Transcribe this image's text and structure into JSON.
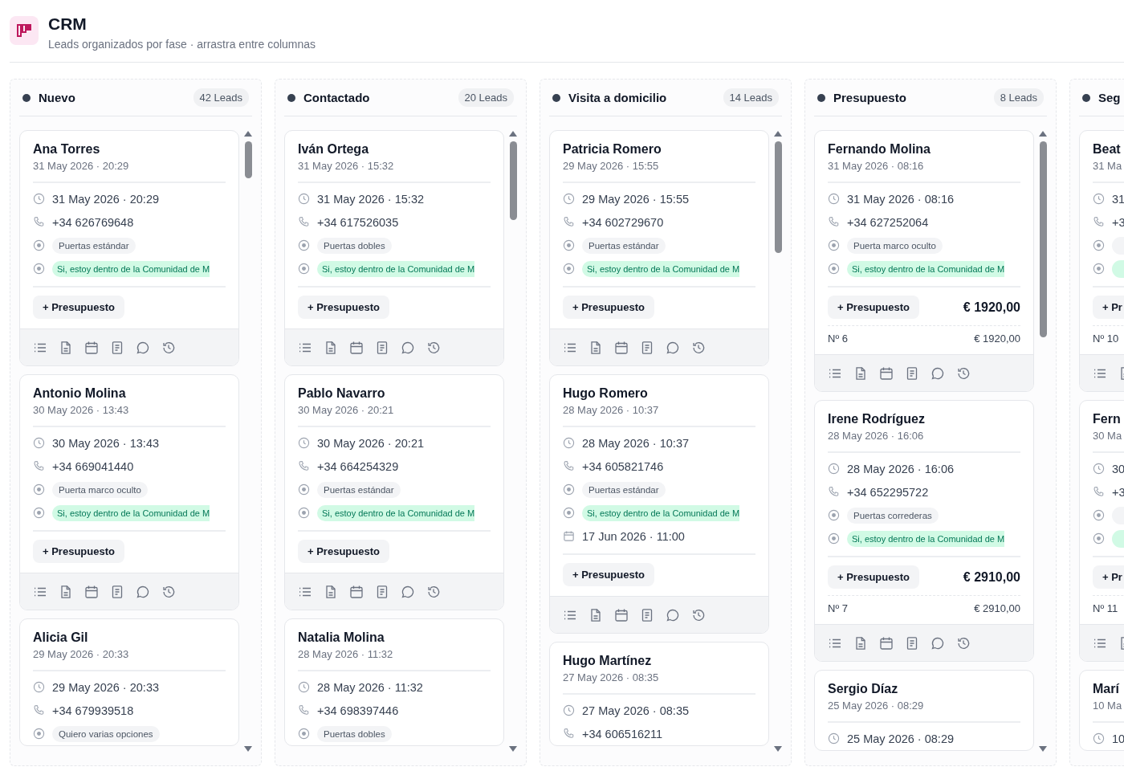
{
  "header": {
    "title": "CRM",
    "subtitle": "Leads organizados por fase · arrastra entre columnas"
  },
  "columns": [
    {
      "name": "Nuevo",
      "count": "42 Leads",
      "cards": [
        {
          "name": "Ana Torres",
          "created": "31 May 2026 · 20:29",
          "rows": [
            {
              "kind": "time",
              "text": "31 May 2026 · 20:29"
            },
            {
              "kind": "phone",
              "text": "+34 626769648"
            },
            {
              "kind": "tag",
              "text": "Puertas estándar"
            },
            {
              "kind": "tag-green",
              "text": "Si, estoy dentro de la Comunidad de M"
            }
          ],
          "button": "+ Presupuesto"
        },
        {
          "name": "Antonio Molina",
          "created": "30 May 2026 · 13:43",
          "rows": [
            {
              "kind": "time",
              "text": "30 May 2026 · 13:43"
            },
            {
              "kind": "phone",
              "text": "+34 669041440"
            },
            {
              "kind": "tag",
              "text": "Puerta marco oculto"
            },
            {
              "kind": "tag-green",
              "text": "Si, estoy dentro de la Comunidad de M"
            }
          ],
          "button": "+ Presupuesto"
        },
        {
          "name": "Alicia Gil",
          "created": "29 May 2026 · 20:33",
          "rows": [
            {
              "kind": "time",
              "text": "29 May 2026 · 20:33"
            },
            {
              "kind": "phone",
              "text": "+34 679939518"
            },
            {
              "kind": "tag",
              "text": "Quiero varias opciones"
            }
          ]
        }
      ]
    },
    {
      "name": "Contactado",
      "count": "20 Leads",
      "cards": [
        {
          "name": "Iván Ortega",
          "created": "31 May 2026 · 15:32",
          "rows": [
            {
              "kind": "time",
              "text": "31 May 2026 · 15:32"
            },
            {
              "kind": "phone",
              "text": "+34 617526035"
            },
            {
              "kind": "tag",
              "text": "Puertas dobles"
            },
            {
              "kind": "tag-green",
              "text": "Si, estoy dentro de la Comunidad de M"
            }
          ],
          "button": "+ Presupuesto"
        },
        {
          "name": "Pablo Navarro",
          "created": "30 May 2026 · 20:21",
          "rows": [
            {
              "kind": "time",
              "text": "30 May 2026 · 20:21"
            },
            {
              "kind": "phone",
              "text": "+34 664254329"
            },
            {
              "kind": "tag",
              "text": "Puertas estándar"
            },
            {
              "kind": "tag-green",
              "text": "Si, estoy dentro de la Comunidad de M"
            }
          ],
          "button": "+ Presupuesto"
        },
        {
          "name": "Natalia Molina",
          "created": "28 May 2026 · 11:32",
          "rows": [
            {
              "kind": "time",
              "text": "28 May 2026 · 11:32"
            },
            {
              "kind": "phone",
              "text": "+34 698397446"
            },
            {
              "kind": "tag",
              "text": "Puertas dobles"
            }
          ]
        }
      ]
    },
    {
      "name": "Visita a domicilio",
      "count": "14 Leads",
      "cards": [
        {
          "name": "Patricia Romero",
          "created": "29 May 2026 · 15:55",
          "rows": [
            {
              "kind": "time",
              "text": "29 May 2026 · 15:55"
            },
            {
              "kind": "phone",
              "text": "+34 602729670"
            },
            {
              "kind": "tag",
              "text": "Puertas estándar"
            },
            {
              "kind": "tag-green",
              "text": "Si, estoy dentro de la Comunidad de M"
            }
          ],
          "button": "+ Presupuesto"
        },
        {
          "name": "Hugo Romero",
          "created": "28 May 2026 · 10:37",
          "rows": [
            {
              "kind": "time",
              "text": "28 May 2026 · 10:37"
            },
            {
              "kind": "phone",
              "text": "+34 605821746"
            },
            {
              "kind": "tag",
              "text": "Puertas estándar"
            },
            {
              "kind": "tag-green",
              "text": "Si, estoy dentro de la Comunidad de M"
            },
            {
              "kind": "appointment",
              "text": "17 Jun 2026 · 11:00"
            }
          ],
          "button": "+ Presupuesto"
        },
        {
          "name": "Hugo Martínez",
          "created": "27 May 2026 · 08:35",
          "rows": [
            {
              "kind": "time",
              "text": "27 May 2026 · 08:35"
            },
            {
              "kind": "phone",
              "text": "+34 606516211"
            }
          ]
        }
      ]
    },
    {
      "name": "Presupuesto",
      "count": "8 Leads",
      "cards": [
        {
          "name": "Fernando Molina",
          "created": "31 May 2026 · 08:16",
          "rows": [
            {
              "kind": "time",
              "text": "31 May 2026 · 08:16"
            },
            {
              "kind": "phone",
              "text": "+34 627252064"
            },
            {
              "kind": "tag",
              "text": "Puerta marco oculto"
            },
            {
              "kind": "tag-green",
              "text": "Si, estoy dentro de la Comunidad de M"
            }
          ],
          "button": "+ Presupuesto",
          "total": "€ 1920,00",
          "quote_no": "Nº 6",
          "quote_amount": "€ 1920,00"
        },
        {
          "name": "Irene Rodríguez",
          "created": "28 May 2026 · 16:06",
          "rows": [
            {
              "kind": "time",
              "text": "28 May 2026 · 16:06"
            },
            {
              "kind": "phone",
              "text": "+34 652295722"
            },
            {
              "kind": "tag",
              "text": "Puertas correderas"
            },
            {
              "kind": "tag-green",
              "text": "Si, estoy dentro de la Comunidad de M"
            }
          ],
          "button": "+ Presupuesto",
          "total": "€ 2910,00",
          "quote_no": "Nº 7",
          "quote_amount": "€ 2910,00"
        },
        {
          "name": "Sergio Díaz",
          "created": "25 May 2026 · 08:29",
          "rows": [
            {
              "kind": "time",
              "text": "25 May 2026 · 08:29"
            }
          ]
        }
      ]
    },
    {
      "name": "Seg",
      "cards": [
        {
          "name": "Beat",
          "created": "31 Ma",
          "rows": [
            {
              "kind": "time",
              "text": "31"
            },
            {
              "kind": "phone",
              "text": "+3"
            },
            {
              "kind": "tag"
            },
            {
              "kind": "tag-green"
            }
          ],
          "button": "+ Pr",
          "quote_no": "Nº 10"
        },
        {
          "name": "Fern",
          "created": "30 Ma",
          "rows": [
            {
              "kind": "time",
              "text": "30"
            },
            {
              "kind": "phone",
              "text": "+3"
            },
            {
              "kind": "tag"
            },
            {
              "kind": "tag-green"
            }
          ],
          "button": "+ Pr",
          "quote_no": "Nº 11"
        },
        {
          "name": "Marí",
          "created": "10 Ma",
          "rows": [
            {
              "kind": "time",
              "text": "10"
            }
          ]
        }
      ]
    }
  ]
}
